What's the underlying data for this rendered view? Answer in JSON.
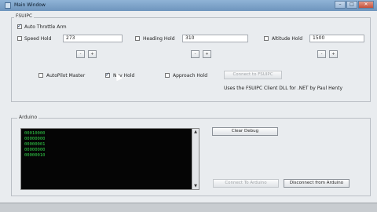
{
  "window": {
    "title": "Main Window"
  },
  "fsuipc": {
    "group_label": "FSUIPC",
    "auto_throttle": {
      "label": "Auto Throttle Arm",
      "checked": true
    },
    "speed_hold": {
      "label": "Speed Hold",
      "value": "273",
      "checked": false
    },
    "heading_hold": {
      "label": "Heading Hold",
      "value": "310",
      "checked": false
    },
    "altitude_hold": {
      "label": "Altitude Hold",
      "value": "1500",
      "checked": false
    },
    "spin_minus": "-",
    "spin_plus": "+",
    "autopilot_master": {
      "label": "AutoPilot Master",
      "checked": false
    },
    "nav_hold": {
      "label": "Nav Hold",
      "checked": true
    },
    "approach_hold": {
      "label": "Approach Hold",
      "checked": false
    },
    "connect_button": "Connect to FSUIPC",
    "credit_text": "Uses the FSUIPC Client DLL for .NET by Paul Henty"
  },
  "arduino": {
    "group_label": "Arduino",
    "console_lines": [
      "00010000",
      "00000000",
      "00000001",
      "00000000",
      "00000010"
    ],
    "clear_button": "Clear Debug",
    "connect_button": "Connect To Arduino",
    "disconnect_button": "Disconnect from Arduino"
  },
  "scroll": {
    "up": "▲",
    "down": "▼"
  },
  "window_buttons": {
    "minimize": "–",
    "maximize": "□",
    "close": "✕"
  }
}
